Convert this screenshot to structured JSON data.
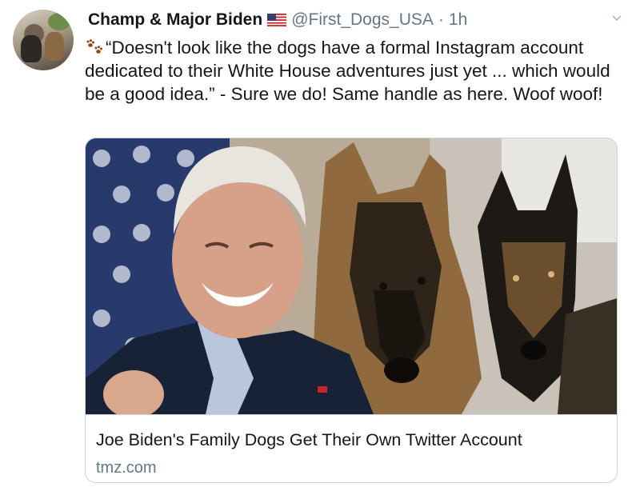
{
  "tweet": {
    "display_name": "Champ & Major Biden",
    "handle": "@First_Dogs_USA",
    "separator": "·",
    "time": "1h",
    "text": "“Doesn't look like the dogs have a formal Instagram account dedicated to their White House adventures just yet ... which would be a good idea.” - Sure we do! Same handle as here. Woof woof!"
  },
  "card": {
    "title": "Joe Biden's Family Dogs Get Their Own Twitter Account",
    "domain": "tmz.com"
  },
  "icons": {
    "verified_flag": "us-flag-icon",
    "paw": "paw-prints-icon",
    "menu": "chevron-down-icon"
  },
  "colors": {
    "text_primary": "#14171a",
    "text_secondary": "#657786",
    "border": "#ccd6dd"
  }
}
